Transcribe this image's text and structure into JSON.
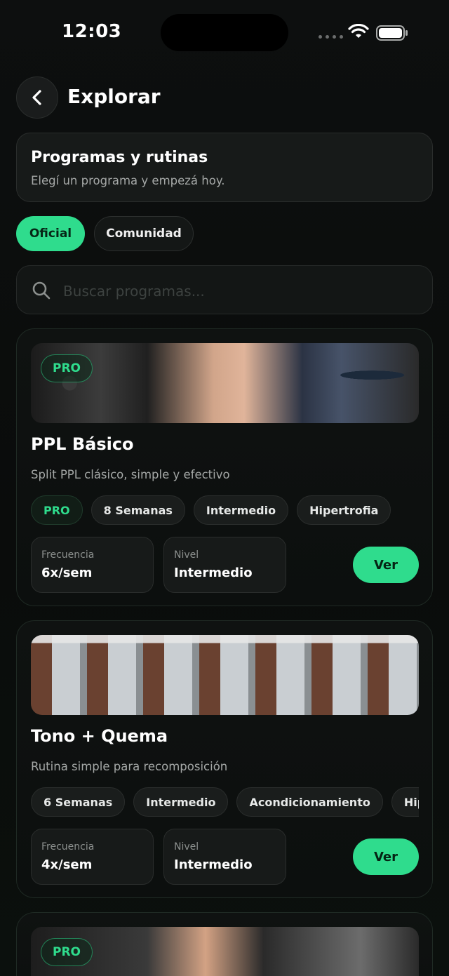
{
  "status_bar": {
    "time": "12:03"
  },
  "header": {
    "title": "Explorar"
  },
  "intro": {
    "title": "Programas y rutinas",
    "subtitle": "Elegí un programa y empezá hoy."
  },
  "tabs": [
    {
      "label": "Oficial",
      "active": true
    },
    {
      "label": "Comunidad",
      "active": false
    }
  ],
  "search": {
    "placeholder": "Buscar programas..."
  },
  "programs": [
    {
      "badge": "PRO",
      "title": "PPL Básico",
      "description": "Split PPL clásico, simple y efectivo",
      "tags": [
        "PRO",
        "8 Semanas",
        "Intermedio",
        "Hipertrofia"
      ],
      "stats": [
        {
          "label": "Frecuencia",
          "value": "6x/sem"
        },
        {
          "label": "Nivel",
          "value": "Intermedio"
        }
      ],
      "action": "Ver"
    },
    {
      "badge": "",
      "title": "Tono + Quema",
      "description": "Rutina simple para recomposición",
      "tags": [
        "6 Semanas",
        "Intermedio",
        "Acondicionamiento",
        "Hipertrofia"
      ],
      "stats": [
        {
          "label": "Frecuencia",
          "value": "4x/sem"
        },
        {
          "label": "Nivel",
          "value": "Intermedio"
        }
      ],
      "action": "Ver"
    },
    {
      "badge": "PRO"
    }
  ],
  "colors": {
    "accent": "#2fdc8d",
    "background": "#0b0c0c",
    "card": "#171a19"
  },
  "icons": [
    "back-chevron-icon",
    "search-icon",
    "wifi-icon",
    "battery-icon",
    "signal-icon"
  ]
}
